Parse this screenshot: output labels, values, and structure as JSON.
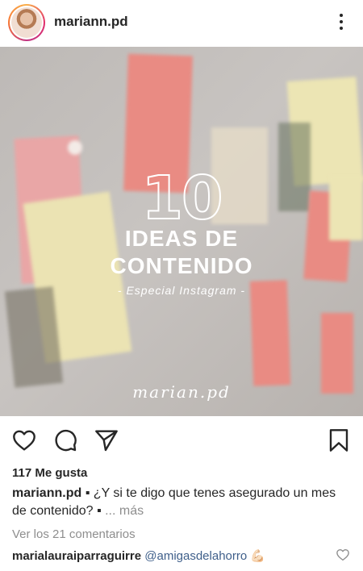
{
  "header": {
    "username": "mariann.pd"
  },
  "post": {
    "image": {
      "number": "10",
      "title_line1": "IDEAS DE",
      "title_line2": "CONTENIDO",
      "subtitle": "- Especial Instagram -",
      "signature": "marian.pd"
    }
  },
  "actions": {
    "like_icon": "heart-icon",
    "comment_icon": "comment-icon",
    "share_icon": "send-icon",
    "save_icon": "bookmark-icon"
  },
  "likes": "117 Me gusta",
  "caption": {
    "username": "mariann.pd",
    "text": "▪ ¿Y si te digo que tenes asegurado un mes de contenido? ▪",
    "more": "... más"
  },
  "comments_link": "Ver los 21 comentarios",
  "comment": {
    "username": "marialauraiparraguirre",
    "mention": "@amigasdelahorro",
    "emoji": "💪🏻"
  },
  "colors": {
    "text": "#262626",
    "muted": "#8e8e8e",
    "mention": "#3f5f8a",
    "note_pink": "#e98b83",
    "note_yellow": "#ece5b4"
  }
}
